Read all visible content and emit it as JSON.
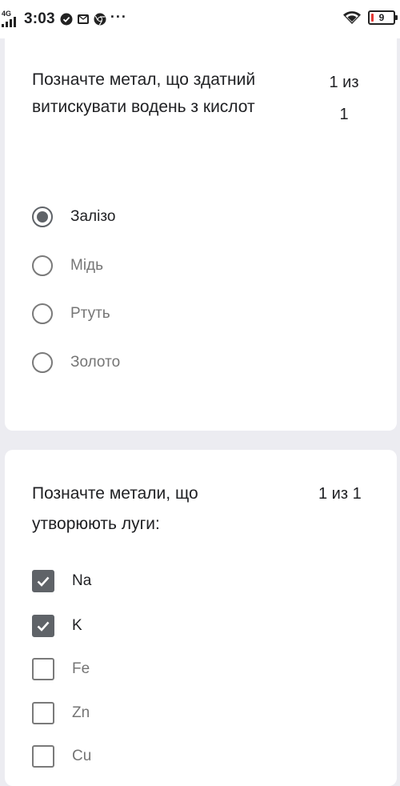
{
  "status_bar": {
    "network": "4G",
    "time": "3:03",
    "icons": [
      "check-circle-icon",
      "mail-icon",
      "chrome-icon",
      "more-dots-icon"
    ],
    "dots": "···",
    "battery_level": "9",
    "battery_color": "#e53935"
  },
  "question1": {
    "text": "Позначте метал, що здатний витискувати водень з кислот",
    "score": "1 из 1",
    "type": "radio",
    "options": [
      {
        "label": "Залізо",
        "selected": true
      },
      {
        "label": "Мідь",
        "selected": false
      },
      {
        "label": "Ртуть",
        "selected": false
      },
      {
        "label": "Золото",
        "selected": false
      }
    ]
  },
  "question2": {
    "text": "Позначте метали, що утворюють луги:",
    "score": "1 из 1",
    "type": "checkbox",
    "options": [
      {
        "label": "Na",
        "checked": true
      },
      {
        "label": "K",
        "checked": true
      },
      {
        "label": "Fe",
        "checked": false
      },
      {
        "label": "Zn",
        "checked": false
      },
      {
        "label": "Cu",
        "checked": false
      }
    ]
  },
  "colors": {
    "background": "#ececf1",
    "card": "#ffffff",
    "control_active": "#5f6368",
    "control_inactive": "#7a7a7a"
  }
}
